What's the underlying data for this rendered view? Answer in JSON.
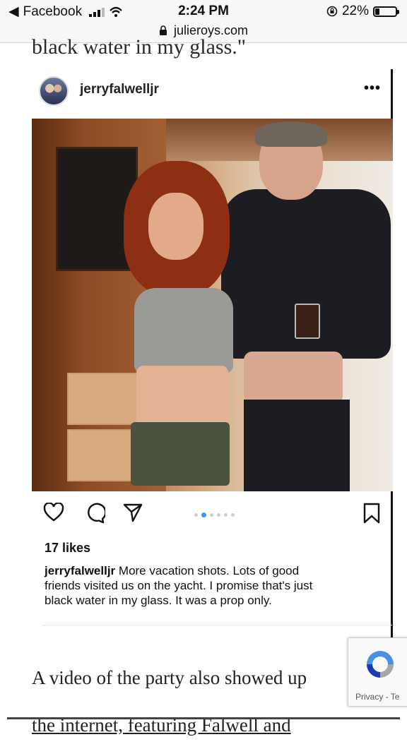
{
  "status_bar": {
    "back_app": "Facebook",
    "time": "2:24 PM",
    "battery": "22%",
    "battery_level": 0.22
  },
  "url_bar": {
    "domain": "julieroys.com"
  },
  "article": {
    "prev_text": "black water in my glass.\"",
    "body_lines": [
      "A video of the party also showed up",
      "the internet, featuring Falwell and"
    ]
  },
  "post": {
    "username": "jerryfalwelljr",
    "more_label": "•••",
    "likes": "17 likes",
    "caption_user": "jerryfalwelljr",
    "caption_lines": [
      "More vacation shots.  Lots of good",
      "friends visited us on the yacht.  I promise that's just",
      "black water in my glass.  It was a prop only."
    ],
    "carousel": {
      "count": 6,
      "active": 1
    }
  },
  "recaptcha": {
    "privacy_text": "Privacy - Te"
  },
  "colors": {
    "accent_blue": "#3897f0",
    "link_dark": "#111111"
  }
}
